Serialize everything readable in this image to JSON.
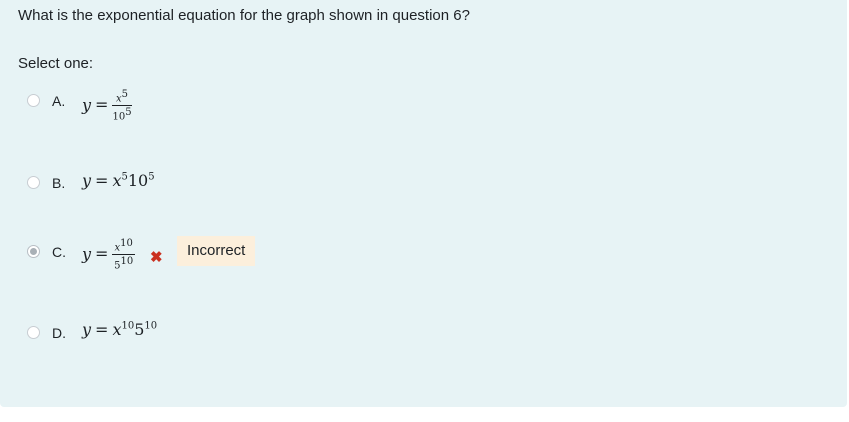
{
  "question": {
    "text": "What is the exponential equation for the graph shown in question 6?",
    "prompt": "Select one:"
  },
  "options": [
    {
      "letter": "A.",
      "lhs": "y",
      "eq": "=",
      "num_base": "x",
      "num_exp": "5",
      "den_base": "10",
      "den_exp": "5",
      "selected": false
    },
    {
      "letter": "B.",
      "lhs": "y",
      "eq": "=",
      "base1": "x",
      "exp1": "5",
      "base2": "10",
      "exp2": "5",
      "selected": false
    },
    {
      "letter": "C.",
      "lhs": "y",
      "eq": "=",
      "num_base": "x",
      "num_exp": "10",
      "den_base": "5",
      "den_exp": "10",
      "selected": true,
      "mark_icon": "cross-icon",
      "mark_glyph": "✖",
      "feedback": "Incorrect"
    },
    {
      "letter": "D.",
      "lhs": "y",
      "eq": "=",
      "base1": "x",
      "exp1": "10",
      "base2": "5",
      "exp2": "10",
      "selected": false
    }
  ],
  "colors": {
    "panel_bg": "#e7f3f5",
    "incorrect_mark": "#ca3120",
    "feedback_bg": "#fcefdc"
  }
}
